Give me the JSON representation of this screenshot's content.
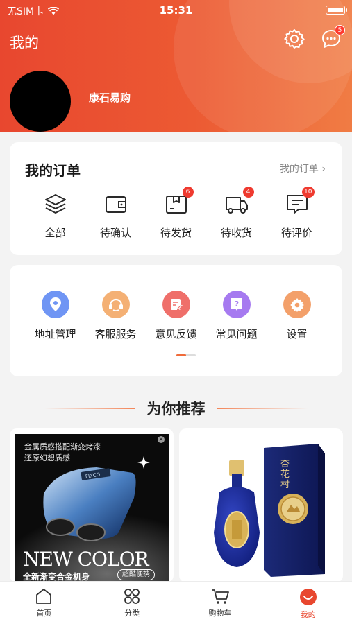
{
  "status_bar": {
    "carrier": "无SIM卡",
    "time": "15:31"
  },
  "header": {
    "title": "我的",
    "messages_badge": "5"
  },
  "profile": {
    "name": "康石易购"
  },
  "orders": {
    "title": "我的订单",
    "more_label": "我的订单",
    "items": [
      {
        "label": "全部",
        "icon": "layers-icon",
        "badge": ""
      },
      {
        "label": "待确认",
        "icon": "wallet-icon",
        "badge": ""
      },
      {
        "label": "待发货",
        "icon": "package-icon",
        "badge": "6"
      },
      {
        "label": "待收货",
        "icon": "truck-icon",
        "badge": "4"
      },
      {
        "label": "待评价",
        "icon": "comment-icon",
        "badge": "10"
      }
    ]
  },
  "services": {
    "items": [
      {
        "label": "地址管理",
        "icon": "location-icon",
        "color": "#6f95f4"
      },
      {
        "label": "客服服务",
        "icon": "headset-icon",
        "color": "#f4b074"
      },
      {
        "label": "意见反馈",
        "icon": "edit-icon",
        "color": "#ef6f6a"
      },
      {
        "label": "常见问题",
        "icon": "question-icon",
        "color": "#a67af0"
      },
      {
        "label": "设置",
        "icon": "gear-icon",
        "color": "#f3a06a"
      }
    ]
  },
  "recommend": {
    "title": "为你推荐",
    "products": [
      {
        "ad_line_1": "金属质感搭配渐变烤漆",
        "ad_line_2": "还原幻想质感",
        "ad_device_label": "FLYCO",
        "ad_headline": "NEW COLOR",
        "ad_sub": "全新渐变合金机身",
        "ad_tag": "超酷便携"
      },
      {
        "box_brand": "杏花村"
      }
    ]
  },
  "tabbar": {
    "items": [
      {
        "label": "首页",
        "icon": "home-icon",
        "active": false
      },
      {
        "label": "分类",
        "icon": "grid-icon",
        "active": false
      },
      {
        "label": "购物车",
        "icon": "cart-icon",
        "active": false
      },
      {
        "label": "我的",
        "icon": "profile-smile-icon",
        "active": true
      }
    ]
  },
  "colors": {
    "brand": "#e8472f",
    "badge": "#ef3a2f"
  }
}
